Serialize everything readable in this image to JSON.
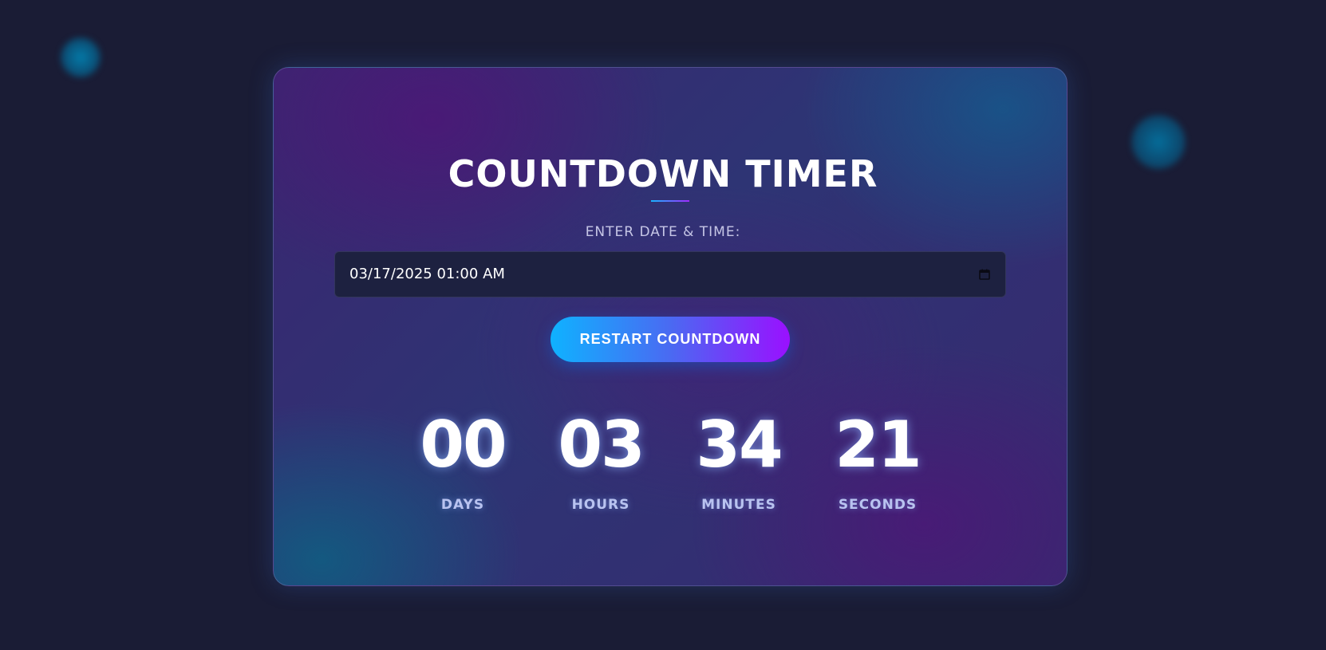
{
  "page": {
    "title": "COUNTDOWN TIMER",
    "field_label": "ENTER DATE & TIME:",
    "date_input": {
      "value": "03/17/2025 01:00 AM",
      "icon": "calendar-icon"
    },
    "restart_button_label": "RESTART COUNTDOWN",
    "countdown": [
      {
        "value": "00",
        "label": "DAYS"
      },
      {
        "value": "03",
        "label": "HOURS"
      },
      {
        "value": "34",
        "label": "MINUTES"
      },
      {
        "value": "21",
        "label": "SECONDS"
      }
    ]
  },
  "colors": {
    "background": "#1a1c35",
    "accent_start": "#0fb2ff",
    "accent_end": "#9a10ff",
    "text": "#ffffff",
    "label": "#b9c3f0"
  }
}
